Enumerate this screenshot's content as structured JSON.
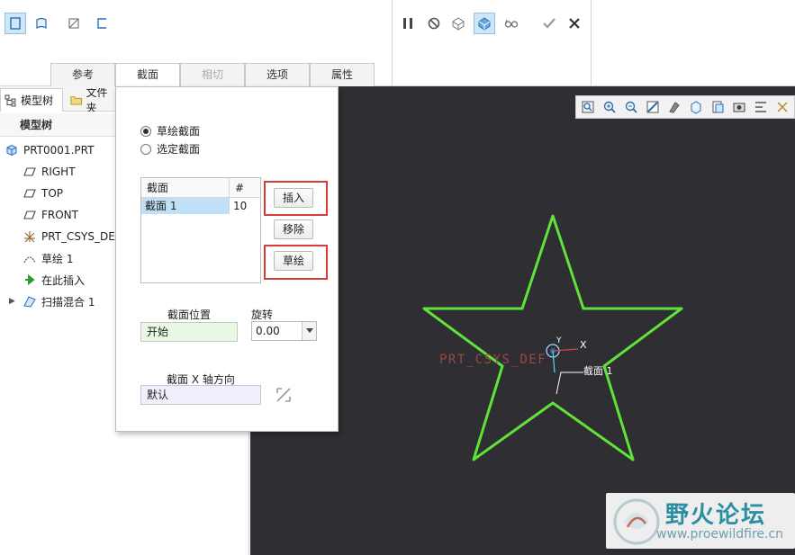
{
  "ribbon": {
    "left_tools": [
      {
        "icon": "solid-section-icon",
        "active": true
      },
      {
        "icon": "surface-section-icon",
        "active": false
      },
      {
        "icon": "thin-section-icon",
        "active": false
      },
      {
        "icon": "open-section-icon",
        "active": false
      }
    ],
    "right_tools": [
      {
        "icon": "pause-icon"
      },
      {
        "icon": "no-preview-icon"
      },
      {
        "icon": "geometry-preview-icon"
      },
      {
        "icon": "verify-mode-icon",
        "active": true
      },
      {
        "icon": "glasses-preview-icon"
      },
      {
        "icon": "checkmark-ok-icon"
      },
      {
        "icon": "close-cancel-icon"
      }
    ],
    "tabs": [
      {
        "label": "参考",
        "state": "normal"
      },
      {
        "label": "截面",
        "state": "active"
      },
      {
        "label": "相切",
        "state": "disabled"
      },
      {
        "label": "选项",
        "state": "normal"
      },
      {
        "label": "属性",
        "state": "normal"
      }
    ]
  },
  "left_panel": {
    "tab_model_tree": "模型树",
    "tab_files": "文件夹",
    "tree_header": "模型树",
    "tree_items": [
      {
        "label": "PRT0001.PRT",
        "icon": "part-icon"
      },
      {
        "label": "RIGHT",
        "icon": "datum-plane-icon"
      },
      {
        "label": "TOP",
        "icon": "datum-plane-icon"
      },
      {
        "label": "FRONT",
        "icon": "datum-plane-icon"
      },
      {
        "label": "PRT_CSYS_DEF",
        "icon": "csys-icon"
      },
      {
        "label": "草绘 1",
        "icon": "sketch-icon"
      },
      {
        "label": "在此插入",
        "icon": "insert-here-arrow-icon"
      },
      {
        "label": "扫描混合 1",
        "icon": "swept-blend-icon"
      }
    ]
  },
  "section_panel": {
    "radio_sketched": "草绘截面",
    "radio_selected": "选定截面",
    "table_col_section": "截面",
    "table_col_number": "#",
    "table_rows": [
      {
        "section": "截面 1",
        "number": "10"
      }
    ],
    "btn_insert": "插入",
    "btn_remove": "移除",
    "btn_sketch": "草绘",
    "position_label": "截面位置",
    "position_value": "开始",
    "rotation_label": "旋转",
    "rotation_value": "0.00",
    "xaxis_label": "截面 X 轴方向",
    "xaxis_value": "默认"
  },
  "graphics": {
    "background": "#2e2e33",
    "sketch_color": "#5fe33a",
    "csys_label": "PRT_CSYS_DEF",
    "axis_x": "X",
    "axis_y": "Y",
    "section_tag": "截面 1",
    "watermark_title": "野火论坛",
    "watermark_url": "www.proewildfire.cn",
    "view_tools": [
      "refit-icon",
      "zoom-in-icon",
      "zoom-out-icon",
      "repaint-icon",
      "display-style-icon",
      "saved-orientations-icon",
      "view-manager-icon",
      "perspective-icon",
      "annotation-display-icon",
      "datum-display-icon"
    ]
  }
}
